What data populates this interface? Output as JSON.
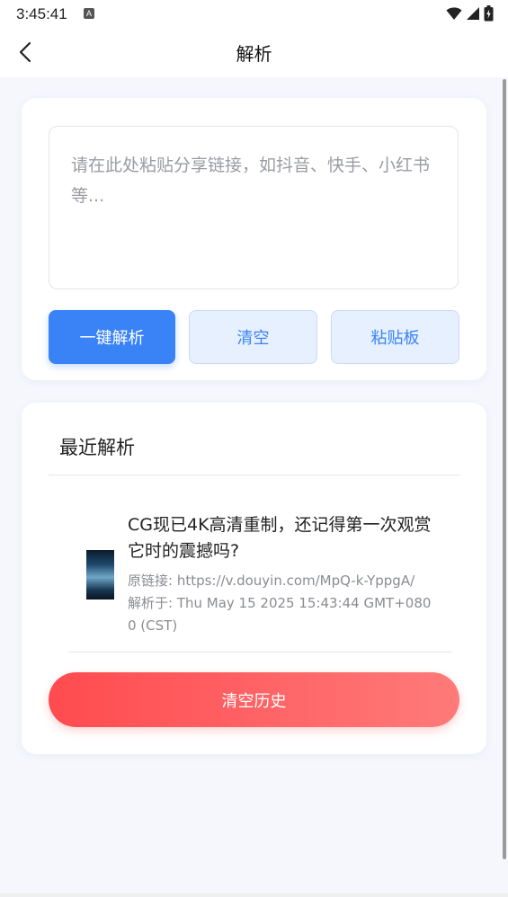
{
  "status_bar": {
    "time": "3:45:41",
    "notification_icon": "A",
    "icons": [
      "wifi-icon",
      "signal-icon",
      "battery-icon"
    ]
  },
  "header": {
    "title": "解析",
    "back_icon": "chevron-left-icon"
  },
  "input_card": {
    "placeholder": "请在此处粘贴分享链接，如抖音、快手、小红书等...",
    "value": "",
    "buttons": {
      "parse": "一键解析",
      "clear": "清空",
      "clipboard": "粘贴板"
    }
  },
  "history": {
    "title": "最近解析",
    "items": [
      {
        "title": "CG现已4K高清重制，还记得第一次观赏它时的震撼吗?",
        "original_link": "原链接: https://v.douyin.com/MpQ-k-YppgA/",
        "parsed_at": "解析于: Thu May 15 2025 15:43:44 GMT+0800 (CST)"
      }
    ],
    "clear_button": "清空历史"
  },
  "colors": {
    "primary": "#3a83f7",
    "primary_light": "#e6f0ff",
    "danger_start": "#ff4b4f",
    "danger_end": "#ff7a7a",
    "background": "#f5f7fd"
  }
}
